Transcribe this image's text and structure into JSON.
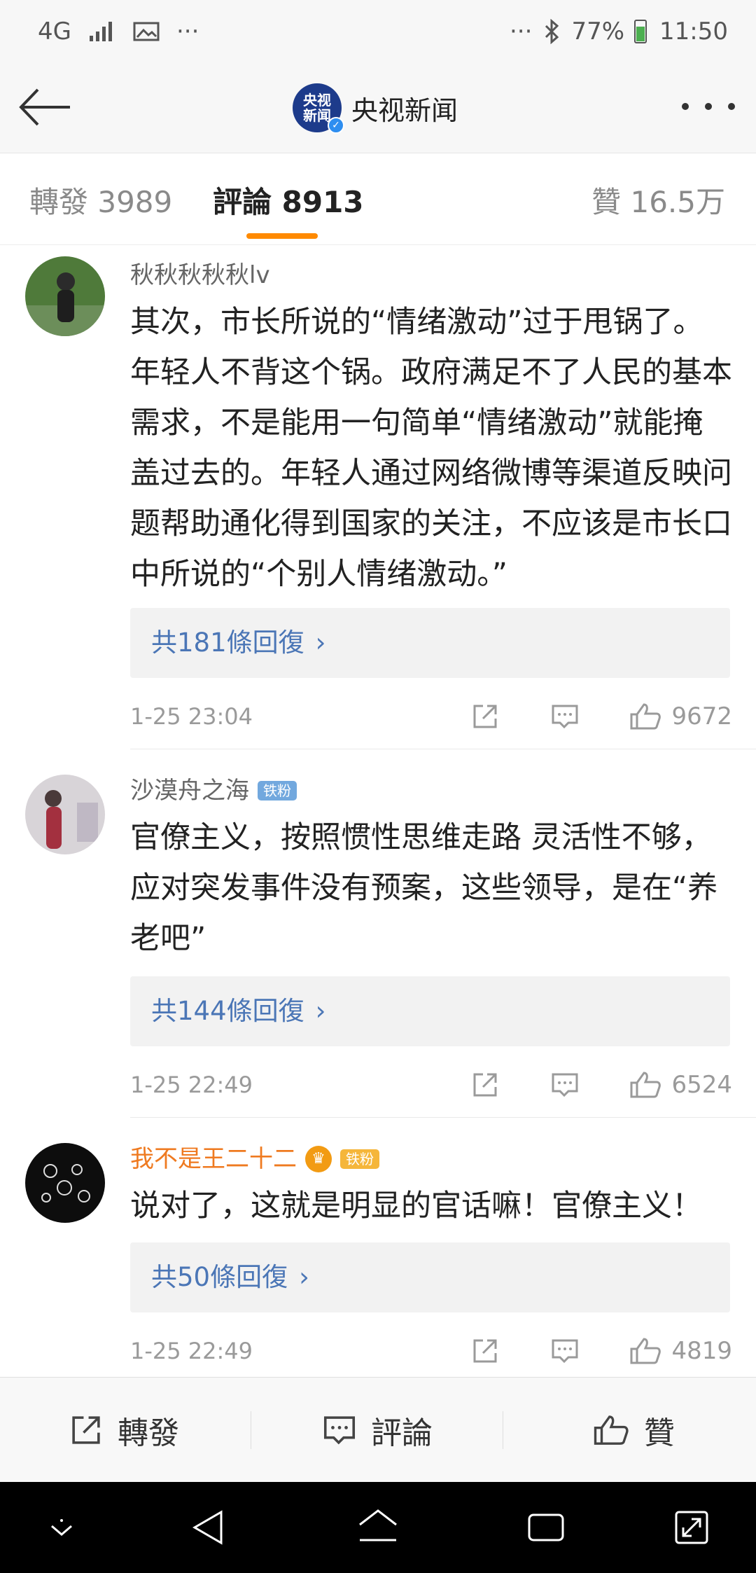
{
  "status_bar": {
    "network": "4G",
    "more": "···",
    "right_more": "···",
    "battery": "77%",
    "time": "11:50"
  },
  "header": {
    "title": "央视新闻",
    "logo_line1": "央视",
    "logo_line2": "新闻"
  },
  "tabs": {
    "forward": "轉發 3989",
    "comment": "評論 8913",
    "like": "贊 16.5万"
  },
  "comments": [
    {
      "username": "秋秋秋秋秋lv",
      "text": "其次，市长所说的“情绪激动”过于甩锅了。年轻人不背这个锅。政府满足不了人民的基本需求，不是能用一句简单“情绪激动”就能掩盖过去的。年轻人通过网络微博等渠道反映问题帮助通化得到国家的关注，不应该是市长口中所说的“个别人情绪激动。”",
      "replies": "共181條回復",
      "time": "1-25 23:04",
      "likes": "9672"
    },
    {
      "username": "沙漠舟之海",
      "badge": "铁粉",
      "text": "官僚主义，按照惯性思维走路 灵活性不够，应对突发事件没有预案，这些领导，是在“养老吧”",
      "replies": "共144條回復",
      "time": "1-25 22:49",
      "likes": "6524"
    },
    {
      "username": "我不是王二十二",
      "badge": "铁粉",
      "text": "说对了，这就是明显的官话嘛！官僚主义！",
      "replies": "共50條回復",
      "time": "1-25 22:49",
      "likes": "4819"
    }
  ],
  "toolbar": {
    "forward": "轉發",
    "comment": "評論",
    "like": "贊"
  },
  "colors": {
    "tab_underline": "#ff8a00",
    "reply_link": "#4b76b6",
    "vip_name": "#ef7a20"
  }
}
